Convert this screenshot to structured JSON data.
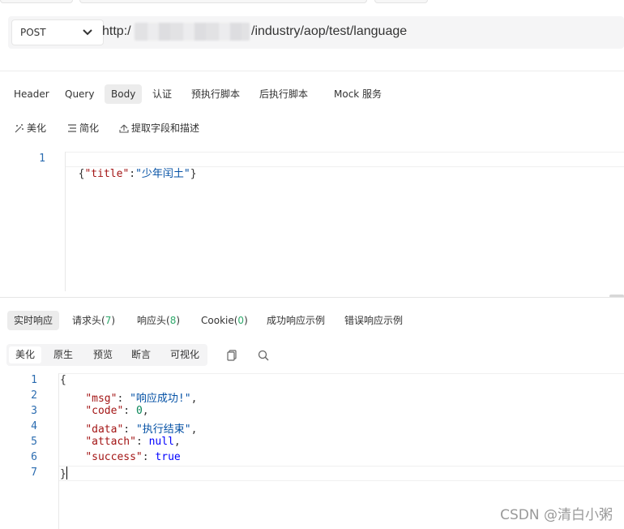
{
  "top_tabs": [
    "",
    "",
    ""
  ],
  "request": {
    "method": "POST",
    "url_prefix": "http:/",
    "url_path": "/industry/aop/test/language"
  },
  "request_tabs": [
    "Header",
    "Query",
    "Body",
    "认证",
    "预执行脚本",
    "后执行脚本",
    "Mock 服务"
  ],
  "active_request_tab": "Body",
  "toolbar": {
    "beautify": "美化",
    "simplify": "简化",
    "extract": "提取字段和描述"
  },
  "body_editor": {
    "line_numbers": [
      "1"
    ],
    "content": {
      "open": "{",
      "key": "\"title\"",
      "colon": ":",
      "value": "\"少年闰土\"",
      "close": "}"
    }
  },
  "response_tabs": {
    "realtime": "实时响应",
    "req_headers": "请求头(",
    "req_headers_count": "7",
    "resp_headers": "响应头(",
    "resp_headers_count": "8",
    "cookie": "Cookie(",
    "cookie_count": "0",
    "close_paren": ")",
    "success_example": "成功响应示例",
    "error_example": "错误响应示例"
  },
  "view_modes": [
    "美化",
    "原生",
    "预览",
    "断言",
    "可视化"
  ],
  "active_view_mode": "美化",
  "icons": [
    "copy-icon",
    "search-icon",
    "magic-wand-icon",
    "list-icon",
    "upload-icon",
    "chevron-down-icon"
  ],
  "response_editor": {
    "line_numbers": [
      "1",
      "2",
      "3",
      "4",
      "5",
      "6",
      "7"
    ],
    "open": "{",
    "close": "}",
    "indent": "    ",
    "fields": [
      {
        "key": "\"msg\"",
        "value": "\"响应成功!\"",
        "type": "string",
        "comma": ","
      },
      {
        "key": "\"code\"",
        "value": "0",
        "type": "number",
        "comma": ","
      },
      {
        "key": "\"data\"",
        "value": "\"执行结束\"",
        "type": "string",
        "comma": ","
      },
      {
        "key": "\"attach\"",
        "value": "null",
        "type": "keyword",
        "comma": ","
      },
      {
        "key": "\"success\"",
        "value": "true",
        "type": "keyword",
        "comma": ""
      }
    ]
  },
  "watermark": "CSDN @清白小粥",
  "colors": {
    "json_key": "#a31515",
    "json_string": "#0451a5",
    "json_number": "#098658",
    "json_keyword": "#0000ff",
    "count_green": "#2fa86b",
    "line_number": "#2b6cb0"
  }
}
